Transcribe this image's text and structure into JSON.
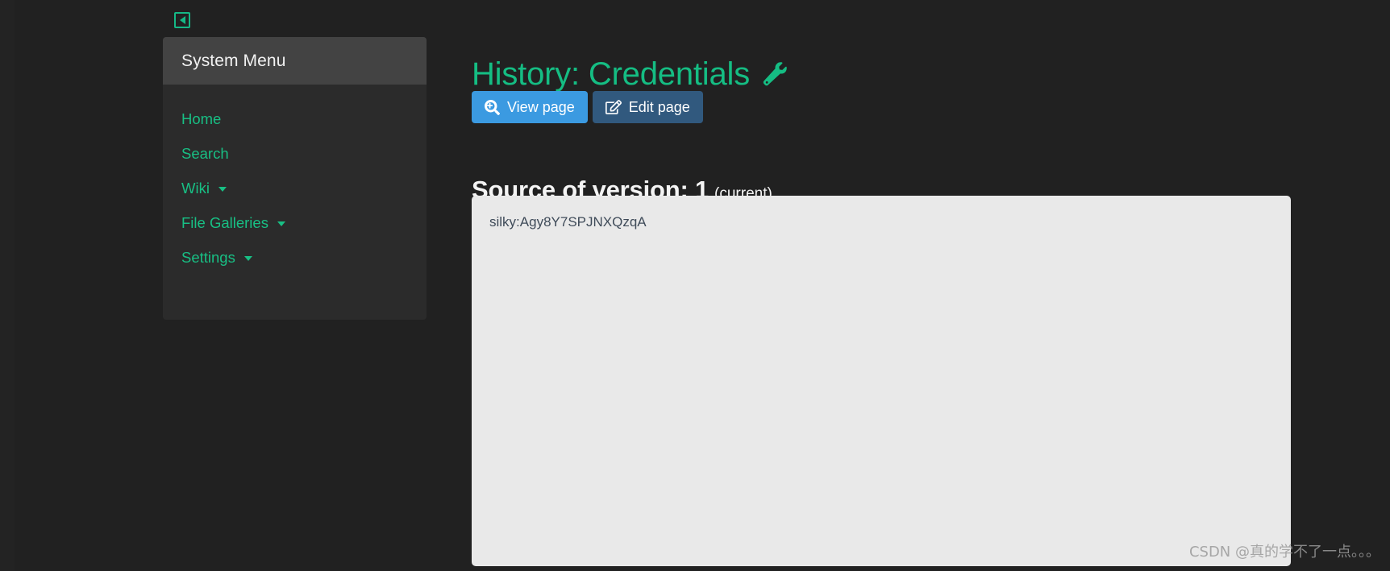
{
  "sidebar": {
    "toggle_icon": "collapse-left-icon",
    "header_title": "System Menu",
    "items": [
      {
        "label": "Home",
        "has_caret": false
      },
      {
        "label": "Search",
        "has_caret": false
      },
      {
        "label": "Wiki",
        "has_caret": true
      },
      {
        "label": "File Galleries",
        "has_caret": true
      },
      {
        "label": "Settings",
        "has_caret": true
      }
    ]
  },
  "main": {
    "page_title": "History: Credentials",
    "title_icon": "wrench-icon",
    "buttons": [
      {
        "label": "View page",
        "icon": "search-plus-icon",
        "color": "#3b9ae1"
      },
      {
        "label": "Edit page",
        "icon": "pencil-square-icon",
        "color": "#31597e"
      }
    ],
    "source_heading": "Source of version: 1",
    "source_heading_note": "(current)",
    "source_text": "silky:Agy8Y7SPJNXQzqA"
  },
  "watermark": {
    "text": "CSDN @真的学不了一点。。。"
  },
  "colors": {
    "accent_green": "#15bd83",
    "page_background": "#212121",
    "sidebar_body": "#2b2b2b",
    "sidebar_header": "#434343",
    "panel_background": "#e9e9e9",
    "primary_button": "#3b9ae1",
    "secondary_button": "#31597e"
  }
}
